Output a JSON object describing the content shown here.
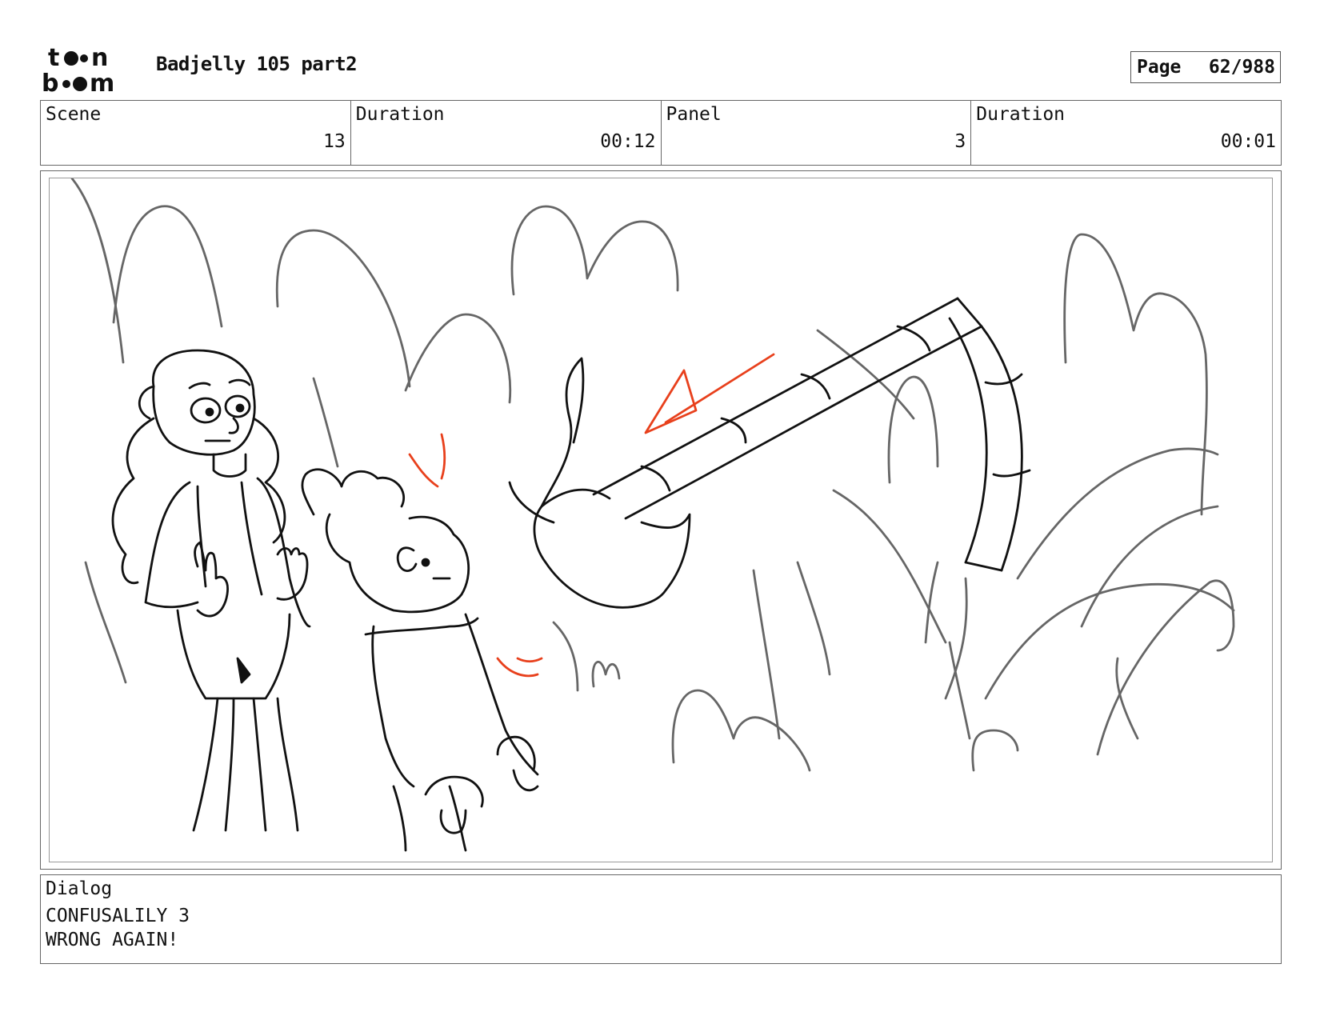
{
  "header": {
    "logo_text": "toon boom",
    "title": "Badjelly 105 part2",
    "page_label": "Page",
    "page_value": "62/988"
  },
  "info": {
    "scene_label": "Scene",
    "scene_value": "13",
    "scene_duration_label": "Duration",
    "scene_duration_value": "00:12",
    "panel_label": "Panel",
    "panel_value": "3",
    "panel_duration_label": "Duration",
    "panel_duration_value": "00:01"
  },
  "dialog": {
    "label": "Dialog",
    "lines": [
      "CONFUSALILY 3",
      "WRONG AGAIN!"
    ]
  },
  "colors": {
    "sketch_line": "#111111",
    "background_plants": "#666666",
    "motion_marks": "#e8401c"
  }
}
